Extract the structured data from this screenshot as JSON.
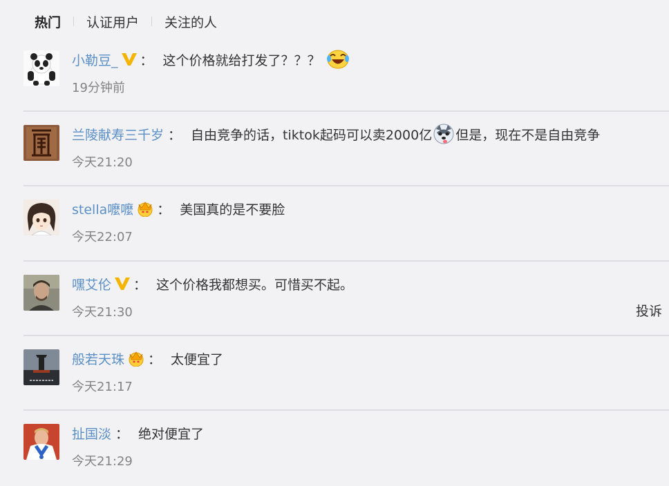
{
  "tabs": [
    "热门",
    "认证用户",
    "关注的人"
  ],
  "colon": "：",
  "report_label": "投诉",
  "comments": [
    {
      "user": "小勒豆_",
      "badge": "v-gold",
      "text": "这个价格就给打发了？？？",
      "text2": "",
      "emoji": "laugh-cry-emoji",
      "time": "19分钟前",
      "avatar": "panda-avatar"
    },
    {
      "user": "兰陵献寿三千岁",
      "badge": "",
      "text": "自由竞争的话，tiktok起码可以卖2000亿",
      "text2": "但是，现在不是自由竞争",
      "emoji": "husky-emoji",
      "time": "今天21:20",
      "avatar": "calligraphy-avatar"
    },
    {
      "user": "stella嚒嚒",
      "badge": "crown",
      "text": "美国真的是不要脸",
      "text2": "",
      "emoji": "",
      "time": "今天22:07",
      "avatar": "anime-girl-avatar"
    },
    {
      "user": "嘿艾伦",
      "badge": "v-gold",
      "text": "这个价格我都想买。可惜买不起。",
      "text2": "",
      "emoji": "",
      "time": "今天21:30",
      "avatar": "man-portrait-avatar"
    },
    {
      "user": "般若天珠",
      "badge": "crown",
      "text": "太便宜了",
      "text2": "",
      "emoji": "",
      "time": "今天21:17",
      "avatar": "westworld-avatar"
    },
    {
      "user": "扯国淡",
      "badge": "",
      "text": "绝对便宜了",
      "text2": "",
      "emoji": "",
      "time": "今天21:29",
      "avatar": "footballer-avatar"
    }
  ],
  "colors": {
    "background": "#f2f2f5",
    "username": "#5a8fc7",
    "time": "#838383",
    "v_badge": "#f5b400"
  }
}
